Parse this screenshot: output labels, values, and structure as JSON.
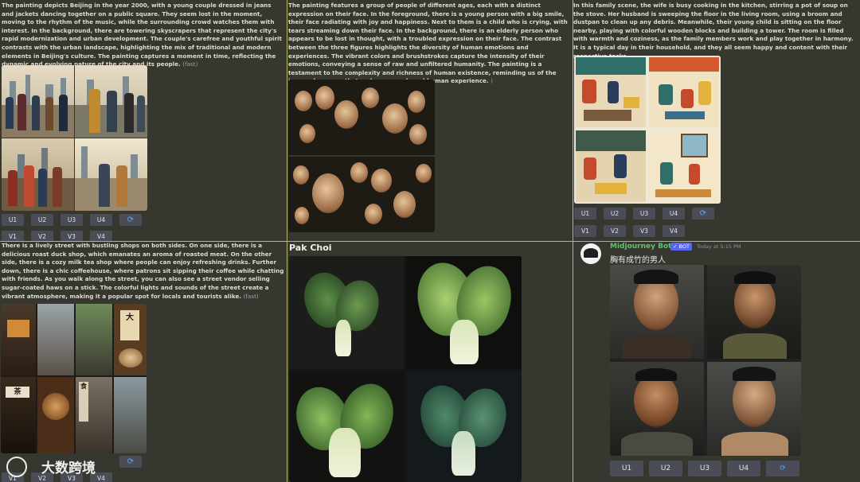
{
  "panel1": {
    "prompt": "The painting depicts Beijing in the year 2000, with a young couple dressed in jeans and jackets dancing together on a public square. They seem lost in the moment, moving to the rhythm of the music, while the surrounding crowd watches them with interest. In the background, there are towering skyscrapers that represent the city's rapid modernization and urban development. The couple's carefree and youthful spirit contrasts with the urban landscape, highlighting the mix of traditional and modern elements in Beijing's culture. The painting captures a moment in time, reflecting the dynamic and evolving nature of the city and its people.",
    "suffix": "(fast)",
    "upscale": [
      "U1",
      "U2",
      "U3",
      "U4"
    ],
    "variation": [
      "V1",
      "V2",
      "V3",
      "V4"
    ]
  },
  "panel2": {
    "prompt": "The painting features a group of people of different ages, each with a distinct expression on their face. In the foreground, there is a young person with a big smile, their face radiating with joy and happiness. Next to them is a child who is crying, with tears streaming down their face. In the background, there is an elderly person who appears to be lost in thought, with a troubled expression on their face. The contrast between the three figures highlights the diversity of human emotions and experiences. The vibrant colors and brushstrokes capture the intensity of their emotions, conveying a sense of raw and unfiltered humanity. The painting is a testament to the complexity and richness of human existence, reminding us of the joys and sorrows that make up our shared human experience.",
    "suffix": ")"
  },
  "panel3": {
    "prompt": "In this family scene, the wife is busy cooking in the kitchen, stirring a pot of soup on the stove. Her husband is sweeping the floor in the living room, using a broom and dustpan to clean up any debris. Meanwhile, their young child is sitting on the floor nearby, playing with colorful wooden blocks and building a tower. The room is filled with warmth and coziness, as the family members work and play together in harmony. It is a typical day in their household, and they all seem happy and content with their respective tasks.",
    "upscale": [
      "U1",
      "U2",
      "U3",
      "U4"
    ],
    "variation": [
      "V1",
      "V2",
      "V3",
      "V4"
    ]
  },
  "panel4": {
    "prompt": "There is a lively street with bustling shops on both sides. On one side, there is a delicious roast duck shop, which emanates an aroma of roasted meat. On the other side, there is a cozy milk tea shop where people can enjoy refreshing drinks. Further down, there is a chic coffeehouse, where patrons sit sipping their coffee while chatting with friends. As you walk along the street, you can also see a street vendor selling sugar-coated haws on a stick. The colorful lights and sounds of the street create a vibrant atmosphere, making it a popular spot for locals and tourists alike.",
    "suffix": "(fast)",
    "variation": [
      "V1",
      "V2",
      "V3",
      "V4"
    ],
    "signs": [
      "大",
      "茶",
      "食"
    ]
  },
  "panel5": {
    "title": "Pak Choi"
  },
  "panel6": {
    "author": "Midjourney Bot",
    "badge": "✓ BOT",
    "time": "Today at 5:15 PM",
    "message": "胸有成竹的男人",
    "upscale": [
      "U1",
      "U2",
      "U3",
      "U4"
    ]
  },
  "watermark": "大数跨境",
  "colors": {
    "divider": "#b9b46a",
    "button": "#4a4d57",
    "accent": "#5aa5ff",
    "bot_name": "#57c76b"
  }
}
